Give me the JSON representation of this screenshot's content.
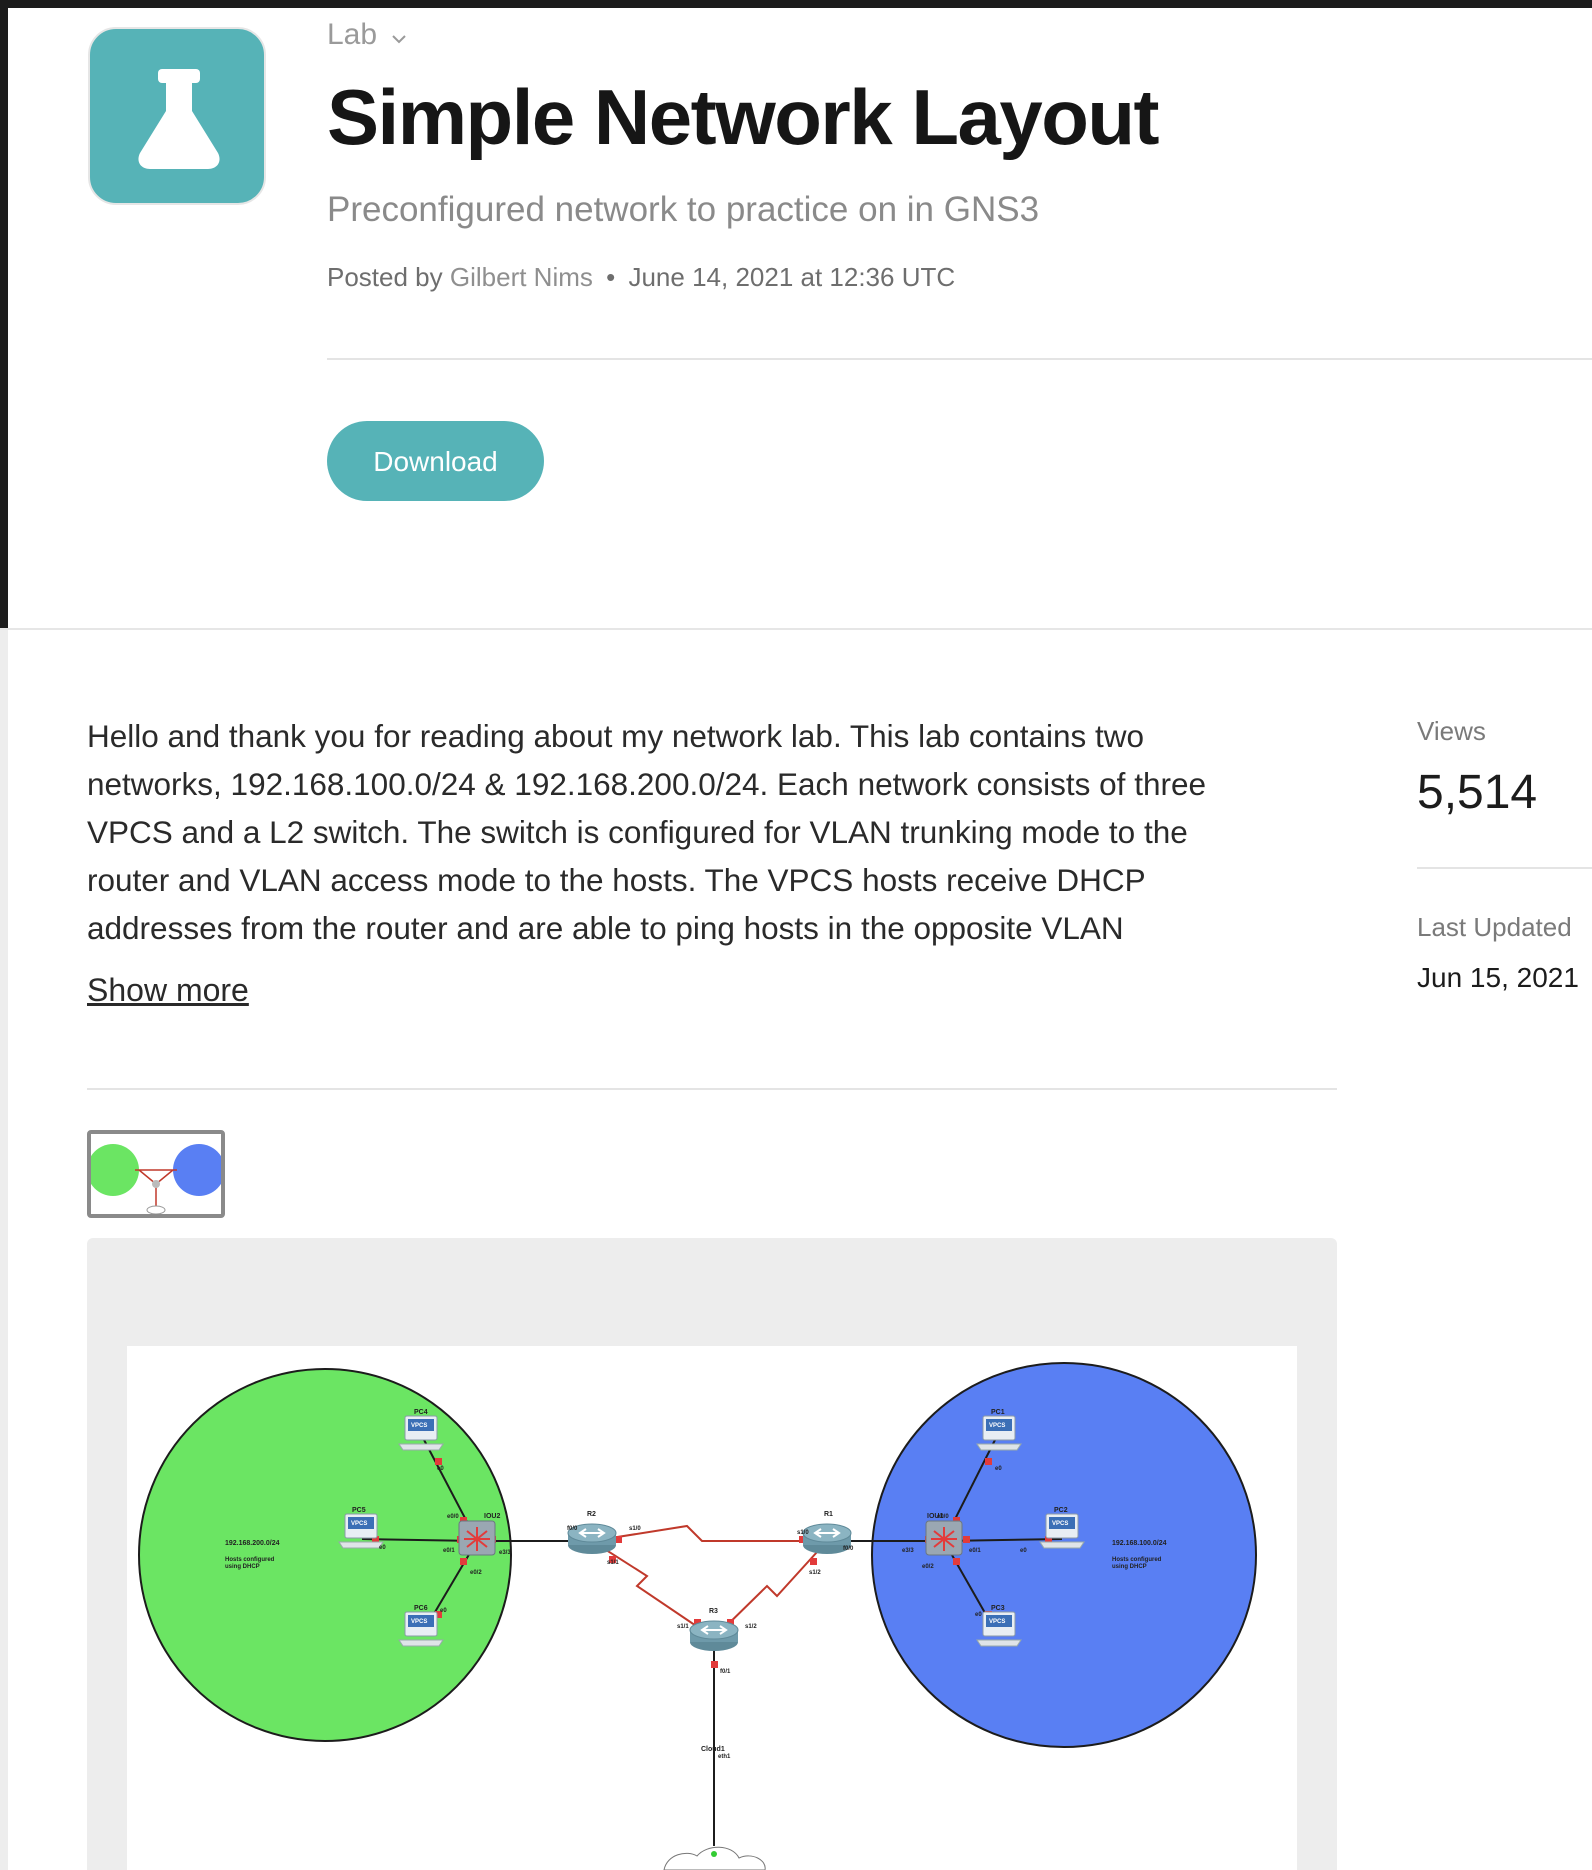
{
  "header": {
    "kind": "Lab",
    "title": "Simple Network Layout",
    "subtitle": "Preconfigured network to practice on in GNS3",
    "posted_by": "Posted by",
    "author": "Gilbert Nims",
    "date": "June 14, 2021 at 12:36 UTC",
    "download_label": "Download"
  },
  "description": {
    "lines": [
      "Hello and thank you for reading about my network lab. This lab contains two",
      "networks, 192.168.100.0/24 & 192.168.200.0/24. Each network consists of three",
      "VPCS and a L2 switch. The switch is configured for VLAN trunking mode to the",
      "router and VLAN access mode to the hosts. The VPCS hosts receive DHCP",
      "addresses from the router and are able to ping hosts in the opposite VLAN"
    ],
    "show_more": "Show more"
  },
  "stats": {
    "views_label": "Views",
    "views_value": "5,514",
    "updated_label": "Last Updated",
    "updated_value": "Jun 15, 2021"
  },
  "diagram": {
    "left_network": {
      "subnet": "192.168.200.0/24",
      "note1": "Hosts configured",
      "note2": "using DHCP",
      "color": "#6be563"
    },
    "right_network": {
      "subnet": "192.168.100.0/24",
      "note1": "Hosts configured",
      "note2": "using DHCP",
      "color": "#597ff3"
    },
    "nodes": {
      "pc1": "PC1",
      "pc2": "PC2",
      "pc3": "PC3",
      "pc4": "PC4",
      "pc5": "PC5",
      "pc6": "PC6",
      "vpcs": "VPCS",
      "iou1": "IOU1",
      "iou2": "IOU2",
      "r1": "R1",
      "r2": "R2",
      "r3": "R3",
      "cloud": "Cloud1"
    },
    "ports": {
      "e0": "e0",
      "e0_0": "e0/0",
      "e0_1": "e0/1",
      "e0_2": "e0/2",
      "e3_3": "e3/3",
      "f0_0": "f0/0",
      "f0_1": "f0/1",
      "s1_0": "s1/0",
      "s1_1": "s1/1",
      "s1_2": "s1/2",
      "eth1": "eth1"
    }
  },
  "colors": {
    "accent": "#56b3b7",
    "link": "#c0392b",
    "port": "#e23b3b"
  }
}
